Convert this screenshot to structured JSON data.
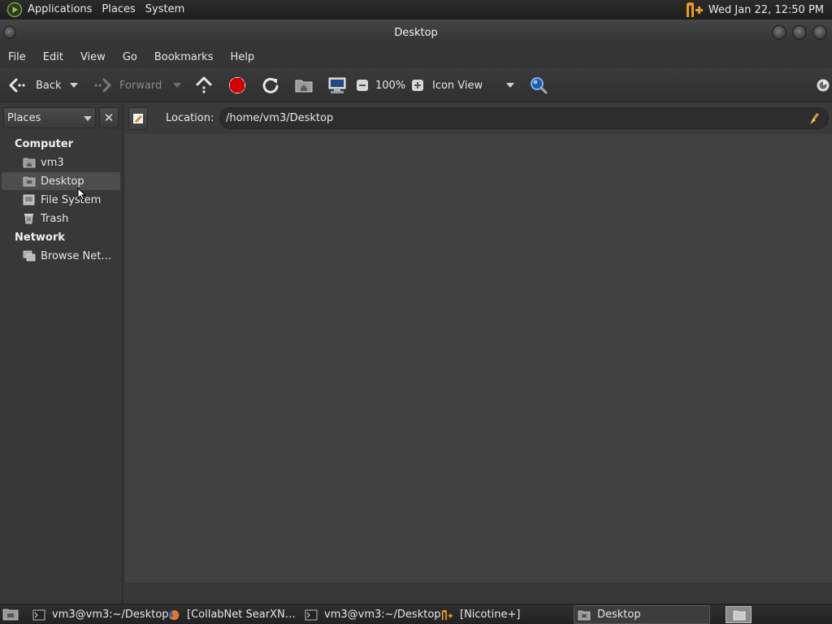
{
  "top_panel": {
    "menus": [
      "Applications",
      "Places",
      "System"
    ],
    "clock": "Wed Jan 22, 12:50 PM",
    "tray_icons": [
      "nicotine-tray-icon"
    ]
  },
  "window": {
    "title": "Desktop"
  },
  "menubar": {
    "items": [
      "File",
      "Edit",
      "View",
      "Go",
      "Bookmarks",
      "Help"
    ]
  },
  "toolbar": {
    "back_label": "Back",
    "forward_label": "Forward",
    "zoom": "100%",
    "view_mode": "Icon View"
  },
  "sidebar": {
    "selector_label": "Places",
    "close_glyph": "✕",
    "sections": [
      {
        "heading": "Computer",
        "items": [
          {
            "label": "vm3",
            "icon": "home-folder-icon"
          },
          {
            "label": "Desktop",
            "icon": "desktop-folder-icon",
            "selected": true
          },
          {
            "label": "File System",
            "icon": "drive-icon"
          },
          {
            "label": "Trash",
            "icon": "trash-icon"
          }
        ]
      },
      {
        "heading": "Network",
        "items": [
          {
            "label": "Browse Net…",
            "icon": "network-icon"
          }
        ]
      }
    ]
  },
  "location": {
    "label": "Location:",
    "path": "/home/vm3/Desktop"
  },
  "taskbar": {
    "tasks": [
      {
        "label": "vm3@vm3:~/Desktop",
        "icon": "terminal-icon",
        "active": false
      },
      {
        "label": "[CollabNet SearXN…",
        "icon": "firefox-icon",
        "active": false
      },
      {
        "label": "vm3@vm3:~/Desktop",
        "icon": "terminal-icon",
        "active": false
      },
      {
        "label": "[Nicotine+]",
        "icon": "nicotine-icon",
        "active": false
      },
      {
        "label": "Desktop",
        "icon": "folder-icon",
        "active": true
      }
    ]
  },
  "colors": {
    "panel_bg": "#1e1e1e",
    "window_bg": "#3a3a3a",
    "content_bg": "#414141",
    "stop_red": "#d40000",
    "nicotine_orange": "#f0a020"
  }
}
